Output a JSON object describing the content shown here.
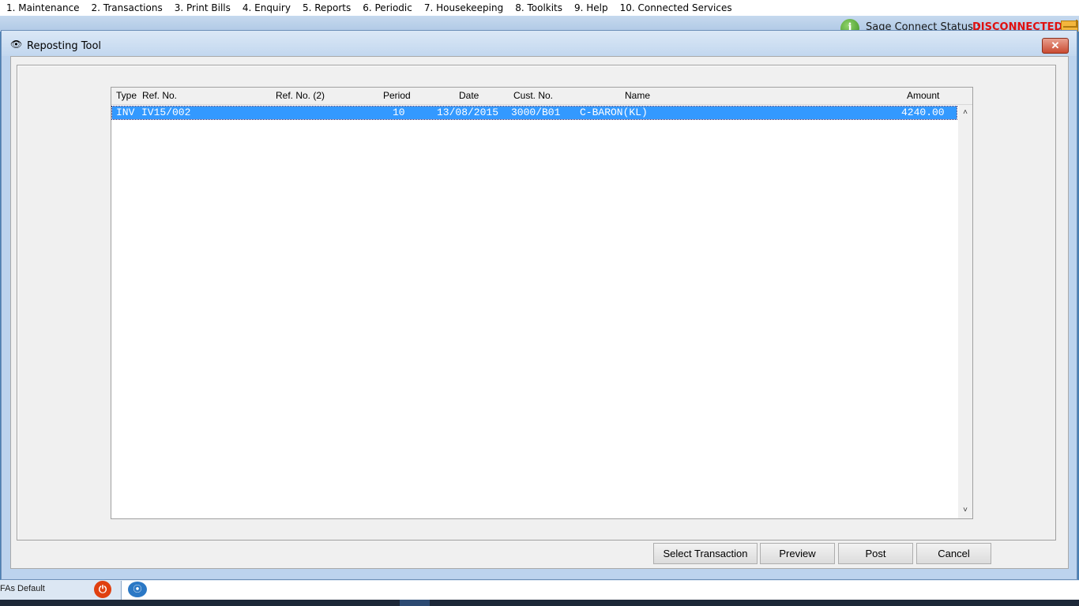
{
  "menu": {
    "items": [
      "1. Maintenance",
      "2. Transactions",
      "3. Print Bills",
      "4. Enquiry",
      "5. Reports",
      "6. Periodic",
      "7. Housekeeping",
      "8. Toolkits",
      "9. Help",
      "10. Connected Services"
    ]
  },
  "status": {
    "label": "Sage Connect Status :",
    "value": "DISCONNECTED",
    "value_color": "#e01010"
  },
  "dialog": {
    "title": "Reposting Tool",
    "close_glyph": "✕"
  },
  "grid": {
    "headers": {
      "type": "Type",
      "ref_no": "Ref. No.",
      "ref_no2": "Ref. No. (2)",
      "period": "Period",
      "date": "Date",
      "cust_no": "Cust. No.",
      "name": "Name",
      "amount": "Amount"
    },
    "rows": [
      {
        "type": "INV",
        "ref_no": "IV15/002",
        "ref_no2": "",
        "period": "10",
        "date": "13/08/2015",
        "cust_no": "3000/B01",
        "name": "C-BARON(KL)",
        "amount": "4240.00",
        "selected": true
      }
    ],
    "selected_color": "#3399ff"
  },
  "buttons": {
    "select_transaction": "Select Transaction",
    "preview": "Preview",
    "post": "Post",
    "cancel": "Cancel"
  },
  "taskbar": {
    "left_text": "FAs Default"
  },
  "icons": {
    "info": "info-icon",
    "mail": "mail-icon",
    "dialog": "document-icon",
    "power": "power-icon",
    "rss": "rss-icon"
  }
}
